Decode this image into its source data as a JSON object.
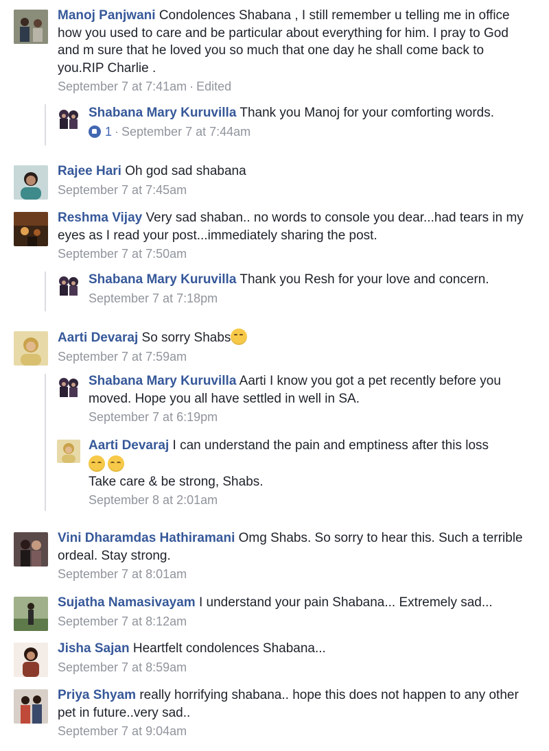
{
  "comments": [
    {
      "author": "Manoj Panjwani",
      "text": "Condolences Shabana , I still remember u telling me in office how you used to care and be particular about everything for him. I pray to God and m sure that he loved you so much that one day he shall come back to you.RIP Charlie .",
      "time": "September 7 at 7:41am",
      "edited": "Edited",
      "avatar_color": "#6b6f5d"
    },
    {
      "author": "Shabana Mary Kuruvilla",
      "text": "Thank you Manoj for your comforting words.",
      "likes": "1",
      "time": "September 7 at 7:44am",
      "avatar_color": "#3b2a44"
    },
    {
      "author": "Rajee Hari",
      "text": "Oh god sad shabana",
      "time": "September 7 at 7:45am",
      "avatar_color": "#3f8a8a"
    },
    {
      "author": "Reshma Vijay",
      "text": "Very sad shaban.. no words to console you dear...had tears in my eyes as I read your post...immediately sharing the post.",
      "time": "September 7 at 7:50am",
      "avatar_color": "#6b3d1e"
    },
    {
      "author": "Shabana Mary Kuruvilla",
      "text": "Thank you Resh for your love and concern.",
      "time": "September 7 at 7:18pm",
      "avatar_color": "#3b2a44"
    },
    {
      "author": "Aarti Devaraj",
      "text": "So sorry Shabs",
      "time": "September 7 at 7:59am",
      "avatar_color": "#c9a24a"
    },
    {
      "author": "Shabana Mary Kuruvilla",
      "text": "Aarti I know you got a pet recently before you moved. Hope you all have settled in well in SA.",
      "time": "September 7 at 6:19pm",
      "avatar_color": "#3b2a44"
    },
    {
      "author": "Aarti Devaraj",
      "text": "I can understand the pain and emptiness after this loss",
      "text2": "Take care & be strong, Shabs.",
      "time": "September 8 at 2:01am",
      "avatar_color": "#c9a24a"
    },
    {
      "author": "Vini Dharamdas Hathiramani",
      "text": "Omg Shabs. So sorry to hear this. Such a terrible ordeal. Stay strong.",
      "time": "September 7 at 8:01am",
      "avatar_color": "#4a3a3a"
    },
    {
      "author": "Sujatha Namasivayam",
      "text": "I understand your pain Shabana... Extremely sad...",
      "time": "September 7 at 8:12am",
      "avatar_color": "#5f7a4a"
    },
    {
      "author": "Jisha Sajan",
      "text": "Heartfelt condolences Shabana...",
      "time": "September 7 at 8:59am",
      "avatar_color": "#8a3b2b"
    },
    {
      "author": "Priya Shyam",
      "text": "really horrifying shabana.. hope this does not happen to any other pet in future..very sad..",
      "time": "September 7 at 9:04am",
      "avatar_color": "#7a4a3a"
    }
  ],
  "icons": {
    "like": "like-icon",
    "kiss_emoji": "face-blowing-kiss-emoji",
    "pensive_emoji": "pensive-face-emoji"
  },
  "colors": {
    "author_name": "#365899",
    "body_text": "#1d2129",
    "meta_text": "#90949c",
    "like_blue": "#4267b2"
  }
}
